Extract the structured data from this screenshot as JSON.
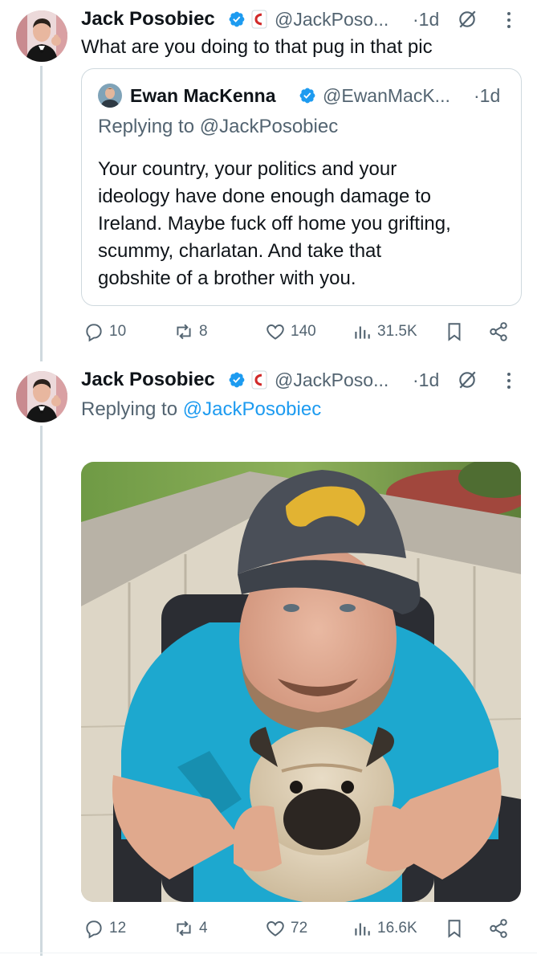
{
  "tweets": [
    {
      "author": "Jack Posobiec",
      "handle": "@JackPoso...",
      "time": "·1d",
      "text": "What are you doing to that pug in that pic",
      "quote": {
        "author": "Ewan MacKenna",
        "handle": "@EwanMacK...",
        "time": "·1d",
        "replying_label": "Replying to ",
        "replying_handle": "@JackPosobiec",
        "lines": [
          "Your country, your politics and your",
          "ideology have done enough damage to",
          "Ireland. Maybe fuck off home you grifting,",
          "scummy, charlatan. And take that",
          "gobshite of a brother with you."
        ]
      },
      "stats": {
        "replies": "10",
        "reposts": "8",
        "likes": "140",
        "views": "31.5K"
      }
    },
    {
      "author": "Jack Posobiec",
      "handle": "@JackPoso...",
      "time": "·1d",
      "replying_label": "Replying to ",
      "replying_handle": "@JackPosobiec",
      "stats": {
        "replies": "12",
        "reposts": "4",
        "likes": "72",
        "views": "16.6K"
      }
    }
  ],
  "icons": {
    "verified": "verified-badge-icon",
    "affiliate": "affiliate-flag-icon",
    "grok": "grok-icon",
    "more": "more-vertical-icon",
    "reply": "reply-icon",
    "repost": "repost-icon",
    "like": "like-icon",
    "views": "views-icon",
    "bookmark": "bookmark-icon",
    "share": "share-icon"
  },
  "colors": {
    "accent": "#1d9bf0",
    "muted": "#536471",
    "text": "#0f1419",
    "border": "#cfd9de"
  }
}
